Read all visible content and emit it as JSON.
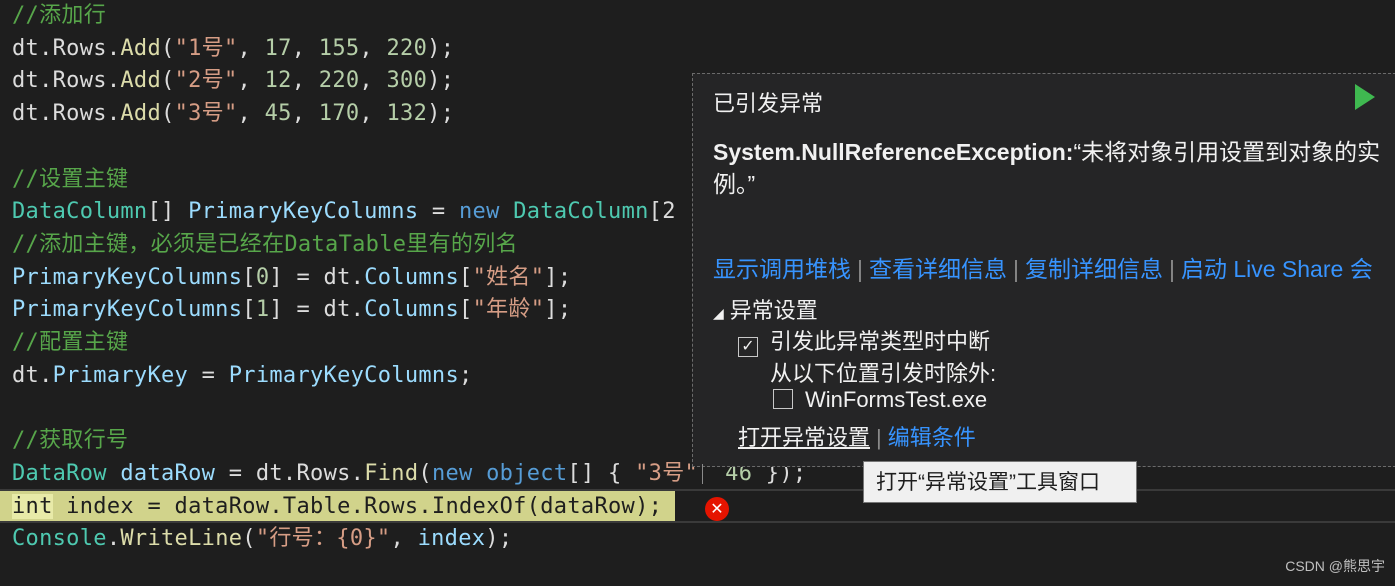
{
  "code_lines": [
    {
      "cls": "cm",
      "text": "//添加行"
    },
    {
      "parts": [
        [
          "pl",
          "dt.Rows."
        ],
        [
          "fn",
          "Add"
        ],
        [
          "pl",
          "("
        ],
        [
          "str",
          "\"1号\""
        ],
        [
          "pl",
          ", "
        ],
        [
          "num",
          "17"
        ],
        [
          "pl",
          ", "
        ],
        [
          "num",
          "155"
        ],
        [
          "pl",
          ", "
        ],
        [
          "num",
          "220"
        ],
        [
          "pl",
          ");"
        ]
      ]
    },
    {
      "parts": [
        [
          "pl",
          "dt.Rows."
        ],
        [
          "fn",
          "Add"
        ],
        [
          "pl",
          "("
        ],
        [
          "str",
          "\"2号\""
        ],
        [
          "pl",
          ", "
        ],
        [
          "num",
          "12"
        ],
        [
          "pl",
          ", "
        ],
        [
          "num",
          "220"
        ],
        [
          "pl",
          ", "
        ],
        [
          "num",
          "300"
        ],
        [
          "pl",
          ");"
        ]
      ]
    },
    {
      "parts": [
        [
          "pl",
          "dt.Rows."
        ],
        [
          "fn",
          "Add"
        ],
        [
          "pl",
          "("
        ],
        [
          "str",
          "\"3号\""
        ],
        [
          "pl",
          ", "
        ],
        [
          "num",
          "45"
        ],
        [
          "pl",
          ", "
        ],
        [
          "num",
          "170"
        ],
        [
          "pl",
          ", "
        ],
        [
          "num",
          "132"
        ],
        [
          "pl",
          ");"
        ]
      ]
    },
    {
      "parts": []
    },
    {
      "cls": "cm",
      "text": "//设置主键"
    },
    {
      "parts": [
        [
          "ty",
          "DataColumn"
        ],
        [
          "pl",
          "[] "
        ],
        [
          "id",
          "PrimaryKeyColumns"
        ],
        [
          "pl",
          " = "
        ],
        [
          "kw",
          "new"
        ],
        [
          "pl",
          " "
        ],
        [
          "ty",
          "DataColumn"
        ],
        [
          "pl",
          "[2"
        ]
      ]
    },
    {
      "cls": "cm",
      "text": "//添加主键，必须是已经在DataTable里有的列名"
    },
    {
      "parts": [
        [
          "id",
          "PrimaryKeyColumns"
        ],
        [
          "pl",
          "["
        ],
        [
          "num",
          "0"
        ],
        [
          "pl",
          "] = dt."
        ],
        [
          "id",
          "Columns"
        ],
        [
          "pl",
          "["
        ],
        [
          "str",
          "\"姓名\""
        ],
        [
          "pl",
          "];"
        ]
      ]
    },
    {
      "parts": [
        [
          "id",
          "PrimaryKeyColumns"
        ],
        [
          "pl",
          "["
        ],
        [
          "num",
          "1"
        ],
        [
          "pl",
          "] = dt."
        ],
        [
          "id",
          "Columns"
        ],
        [
          "pl",
          "["
        ],
        [
          "str",
          "\"年龄\""
        ],
        [
          "pl",
          "];"
        ]
      ]
    },
    {
      "cls": "cm",
      "text": "//配置主键"
    },
    {
      "parts": [
        [
          "pl",
          "dt."
        ],
        [
          "id",
          "PrimaryKey"
        ],
        [
          "pl",
          " = "
        ],
        [
          "id",
          "PrimaryKeyColumns"
        ],
        [
          "pl",
          ";"
        ]
      ]
    },
    {
      "parts": []
    },
    {
      "cls": "cm",
      "text": "//获取行号"
    },
    {
      "parts": [
        [
          "ty",
          "DataRow"
        ],
        [
          "pl",
          " "
        ],
        [
          "id",
          "dataRow"
        ],
        [
          "pl",
          " = dt.Rows."
        ],
        [
          "fn",
          "Find"
        ],
        [
          "pl",
          "("
        ],
        [
          "kw",
          "new"
        ],
        [
          "pl",
          " "
        ],
        [
          "kw",
          "object"
        ],
        [
          "pl",
          "[] { "
        ],
        [
          "str",
          "\"3号\""
        ],
        [
          "pl",
          "  "
        ],
        [
          "num",
          "46"
        ],
        [
          "pl",
          " });"
        ]
      ]
    },
    {
      "parts": [
        [
          "kw",
          "int"
        ],
        [
          "pl",
          " index = dataRow.Table.Rows.IndexOf(dataRow);"
        ]
      ],
      "highlight": true
    },
    {
      "parts": [
        [
          "ty",
          "Console"
        ],
        [
          "pl",
          "."
        ],
        [
          "fn",
          "WriteLine"
        ],
        [
          "pl",
          "("
        ],
        [
          "str",
          "\"行号：{0}\""
        ],
        [
          "pl",
          ", "
        ],
        [
          "id",
          "index"
        ],
        [
          "pl",
          ");"
        ]
      ]
    }
  ],
  "exception_panel": {
    "title": "已引发异常",
    "exception_type": "System.NullReferenceException:",
    "message": "“未将对象引用设置到对象的实例。”",
    "links": [
      "显示调用堆栈",
      "查看详细信息",
      "复制详细信息",
      "启动 Live Share 会"
    ],
    "settings_header": "异常设置",
    "break_checkbox_label": "引发此异常类型时中断",
    "break_checked": true,
    "except_label": "从以下位置引发时除外:",
    "module_checkbox_label": "WinFormsTest.exe",
    "module_checked": false,
    "open_settings_link": "打开异常设置",
    "edit_conditions_link": "编辑条件"
  },
  "tooltip": "打开“异常设置”工具窗口",
  "watermark": "CSDN @熊思宇",
  "colors": {
    "accent": "#3794ff",
    "error": "#e51400",
    "play": "#3fb950"
  }
}
